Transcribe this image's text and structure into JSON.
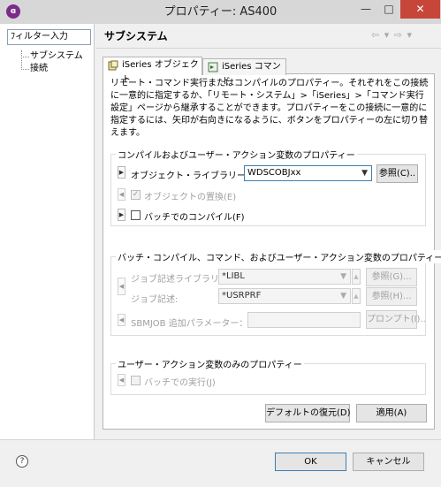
{
  "window": {
    "title": "プロパティー: AS400",
    "minimize": "—",
    "maximize": "□",
    "close": "✕",
    "app_icon": "ɞ"
  },
  "filter": {
    "text": "ﾌィルター入力"
  },
  "tree": {
    "items": [
      "サブシステム",
      "接続"
    ]
  },
  "page": {
    "title": "サブシステム",
    "nav": "⇦ ▾ ⇨ ▾"
  },
  "tabs": [
    {
      "label": "iSeries オブジェクト",
      "icon": "object-icon",
      "active": true
    },
    {
      "label": "iSeries コマンド",
      "icon": "command-icon",
      "active": false
    }
  ],
  "description": "リモート・コマンド実行またはコンパイルのプロパティー。それぞれをこの接続に一意的に指定するか、「リモート・システム」>「iSeries」>「コマンド実行設定」ページから継承することができます。プロパティーをこの接続に一意的に指定するには、矢印が右向きになるように、ボタンをプロパティーの左に切り替えます。",
  "group_compile": {
    "title": "コンパイルおよびユーザー・アクション変数のプロパティー",
    "objlib_label": "オブジェクト・ライブラリー(B)：",
    "objlib_value": "WDSCOBJxx",
    "browse_button": "参照(C)..",
    "replace_label": "オブジェクトの置換(E)",
    "batch_compile_label": "バッチでのコンパイル(F)"
  },
  "group_batch": {
    "title": "バッチ・コンパイル、コマンド、およびユーザー・アクション変数のプロパティー",
    "jobdesc_lib_label": "ジョブ記述ライブラリー:",
    "jobdesc_lib_value": "*LIBL",
    "jobdesc_lib_button": "参照(G)...",
    "jobdesc_label": "ジョブ記述:",
    "jobdesc_value": "*USRPRF",
    "jobdesc_button": "参照(H)...",
    "sbmjob_label": "SBMJOB 追加パラメーター：",
    "sbmjob_value": "",
    "prompt_button": "プロンプト(I).."
  },
  "group_user": {
    "title": "ユーザー・アクション変数のみのプロパティー",
    "batch_run_label": "バッチでの実行(J)"
  },
  "actions": {
    "restore_defaults": "デフォルトの復元(D)",
    "apply": "適用(A)",
    "ok": "OK",
    "cancel": "キャンセル"
  },
  "help": {
    "icon": "?"
  }
}
